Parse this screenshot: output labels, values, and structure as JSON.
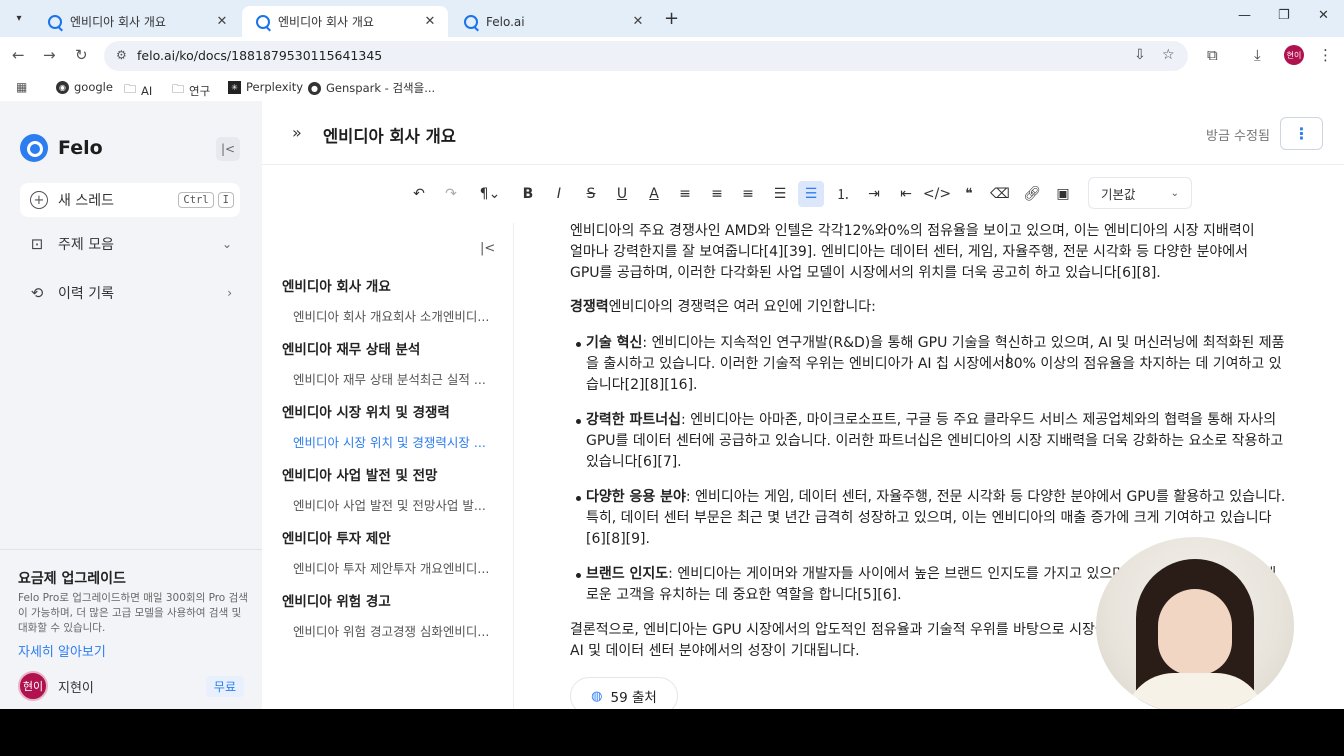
{
  "browser": {
    "tabs": [
      {
        "label": "엔비디아 회사 개요"
      },
      {
        "label": "엔비디아 회사 개요"
      },
      {
        "label": "Felo.ai"
      }
    ],
    "url": "felo.ai/ko/docs/1881879530115641345",
    "bookmarks": [
      "google",
      "AI",
      "연구",
      "Perplexity",
      "Genspark - 검색을..."
    ],
    "profile_initials": "현이"
  },
  "sidebar": {
    "logo": "Felo",
    "new_thread": "새 스레드",
    "shortcut": [
      "Ctrl",
      "I"
    ],
    "nav": [
      {
        "label": "주제 모음",
        "icon": "bookmark-icon"
      },
      {
        "label": "이력 기록",
        "icon": "history-icon"
      }
    ],
    "upgrade": {
      "title": "요금제 업그레이드",
      "desc": "Felo Pro로 업그레이드하면 매일 300회의 Pro 검색이 가능하며, 더 많은 고급 모델을 사용하여 검색 및 대화할 수 있습니다.",
      "link": "자세히 알아보기"
    },
    "user": {
      "avatar": "현이",
      "name": "지현이",
      "plan": "무료"
    }
  },
  "doc": {
    "title": "엔비디아 회사 개요",
    "saved_status": "방금 수정됨",
    "style_select": "기본값"
  },
  "outline": [
    {
      "heading": "엔비디아 회사 개요",
      "sub": "엔비디아 회사 개요회사 소개엔비디..."
    },
    {
      "heading": "엔비디아 재무 상태 분석",
      "sub": "엔비디아 재무 상태 분석최근 실적 ..."
    },
    {
      "heading": "엔비디아 시장 위치 및 경쟁력",
      "sub": "엔비디아 시장 위치 및 경쟁력시장 ..."
    },
    {
      "heading": "엔비디아 사업 발전 및 전망",
      "sub": "엔비디아 사업 발전 및 전망사업 발..."
    },
    {
      "heading": "엔비디아 투자 제안",
      "sub": "엔비디아 투자 제안투자 개요엔비디..."
    },
    {
      "heading": "엔비디아 위험 경고",
      "sub": "엔비디아 위험 경고경쟁 심화엔비디..."
    }
  ],
  "content": {
    "para1": "엔비디아의 주요 경쟁사인 AMD와 인텔은 각각12%와0%의 점유율을 보이고 있으며, 이는 엔비디아의 시장 지배력이 얼마나 강력한지를 잘 보여줍니다[4][39]. 엔비디아는 데이터 센터, 게임, 자율주행, 전문 시각화 등 다양한 분야에서 GPU를 공급하며, 이러한 다각화된 사업 모델이 시장에서의 위치를 더욱 공고히 하고 있습니다[6][8].",
    "para2_lead": "경쟁력",
    "para2": "엔비디아의 경쟁력은 여러 요인에 기인합니다:",
    "bullets": [
      {
        "lead": "기술 혁신",
        "text": ": 엔비디아는 지속적인 연구개발(R&D)을 통해 GPU 기술을 혁신하고 있으며, AI 및 머신러닝에 최적화된 제품을 출시하고 있습니다. 이러한 기술적 우위는 엔비디아가 AI 칩 시장에서80% 이상의 점유율을 차지하는 데 기여하고 있습니다[2][8][16]."
      },
      {
        "lead": "강력한 파트너십",
        "text": ": 엔비디아는 아마존, 마이크로소프트, 구글 등 주요 클라우드 서비스 제공업체와의 협력을 통해 자사의 GPU를 데이터 센터에 공급하고 있습니다. 이러한 파트너십은 엔비디아의 시장 지배력을 더욱 강화하는 요소로 작용하고 있습니다[6][7]."
      },
      {
        "lead": "다양한 응용 분야",
        "text": ": 엔비디아는 게임, 데이터 센터, 자율주행, 전문 시각화 등 다양한 분야에서 GPU를 활용하고 있습니다. 특히, 데이터 센터 부문은 최근 몇 년간 급격히 성장하고 있으며, 이는 엔비디아의 매출 증가에 크게 기여하고 있습니다[6][8][9]."
      },
      {
        "lead": "브랜드 인지도",
        "text": ": 엔비디아는 게이머와 개발자들 사이에서 높은 브랜드 인지도를 가지고 있으며, 고객 충성도를 높이고 새로운 고객을 유치하는 데 중요한 역할을 합니다[5][6]."
      }
    ],
    "para3": "결론적으로, 엔비디아는 GPU 시장에서의 압도적인 점유율과 기술적 우위를 바탕으로 시장을 선도하고 있으며, 앞으로도 AI 및 데이터 센터 분야에서의 성장이 기대됩니다.",
    "sources": "59 출처"
  }
}
